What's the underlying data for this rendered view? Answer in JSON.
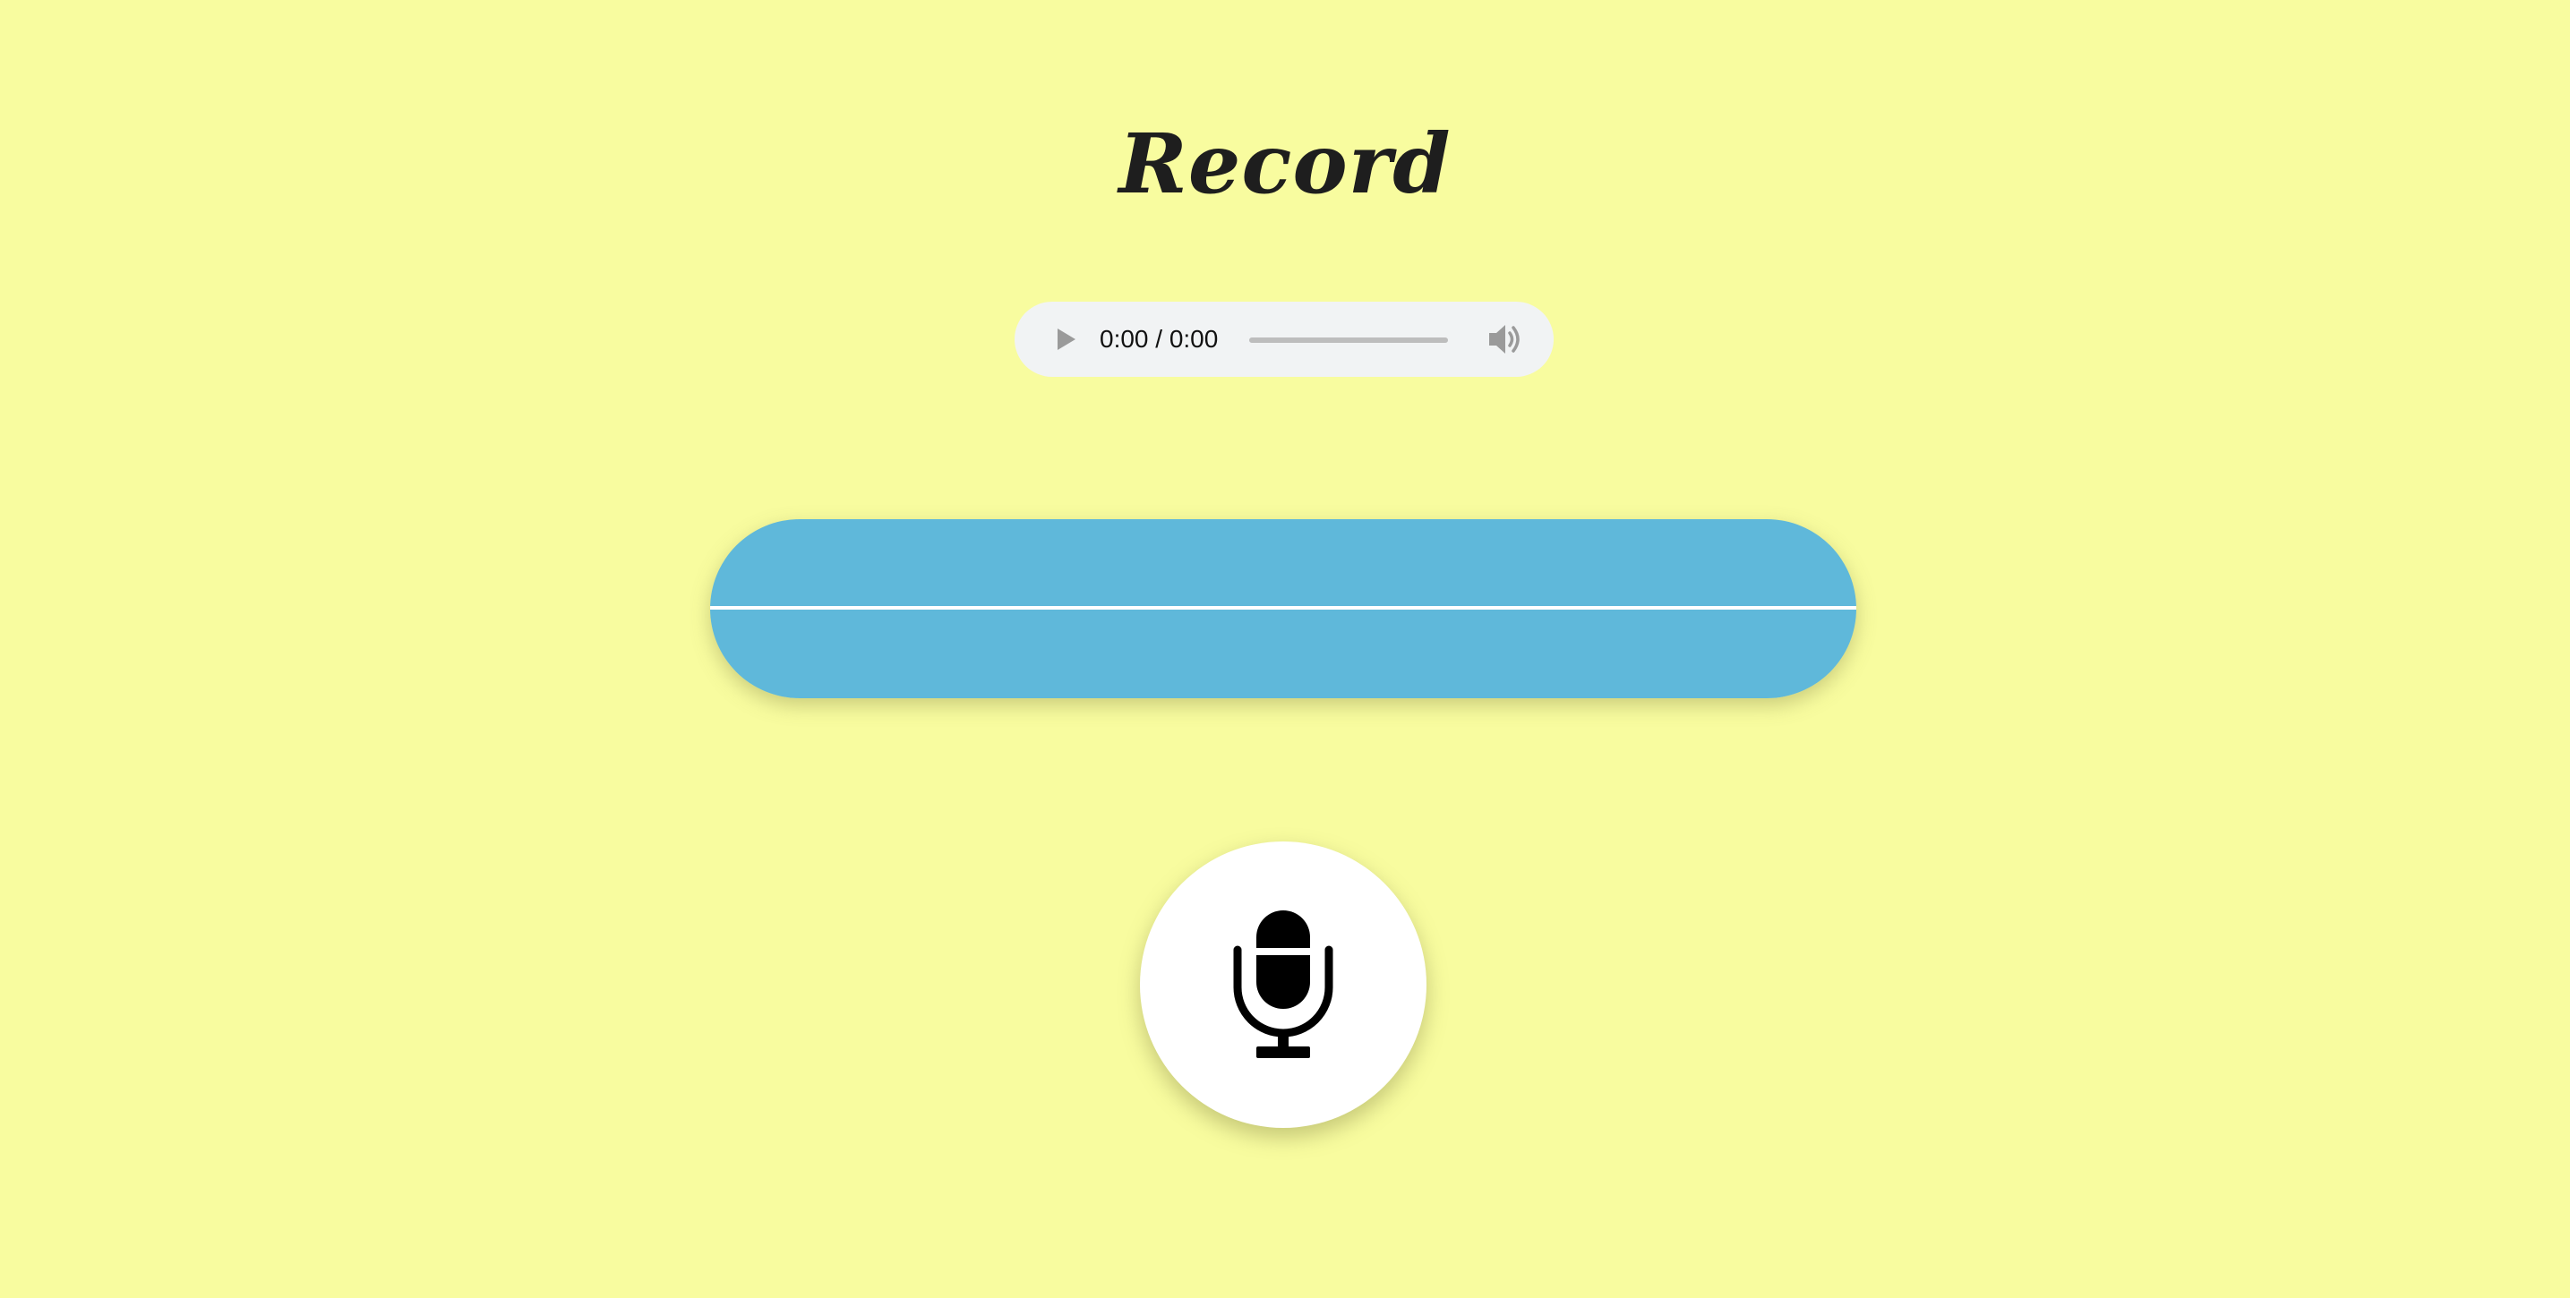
{
  "page": {
    "title": "Record",
    "background_color": "#f8fc9f"
  },
  "audio_player": {
    "time_display": "0:00 / 0:00",
    "current_time": "0:00",
    "duration": "0:00",
    "progress": 0,
    "play_icon": "play-icon",
    "volume_icon": "volume-icon",
    "background_color": "#f1f3f4"
  },
  "waveform": {
    "background_color": "#5fb8da",
    "line_color": "#ffffff"
  },
  "record_button": {
    "icon": "microphone-icon",
    "background_color": "#ffffff"
  }
}
